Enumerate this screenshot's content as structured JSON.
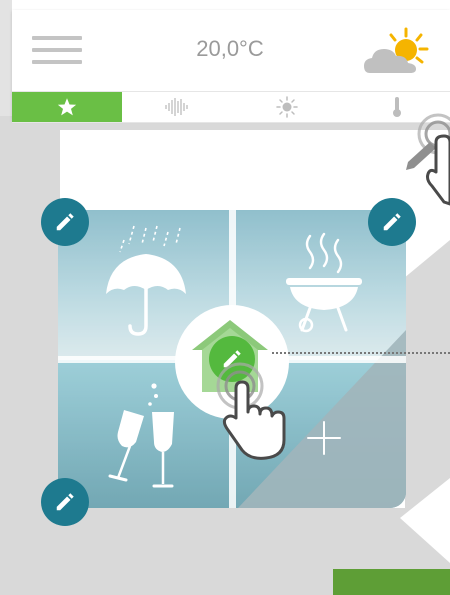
{
  "header": {
    "temperature": "20,0°C",
    "menu_icon": "hamburger-menu-icon",
    "weather_icon": "partly-sunny-icon"
  },
  "tabs": [
    {
      "id": "favorites",
      "icon": "star-icon",
      "active": true
    },
    {
      "id": "sound",
      "icon": "sound-wave-icon",
      "active": false
    },
    {
      "id": "light",
      "icon": "sun-icon",
      "active": false
    },
    {
      "id": "temperature",
      "icon": "thermometer-icon",
      "active": false
    }
  ],
  "scenes": [
    {
      "id": "rain",
      "icon": "umbrella-rain-icon"
    },
    {
      "id": "barbecue",
      "icon": "barbecue-grill-icon"
    },
    {
      "id": "party",
      "icon": "champagne-glasses-icon"
    },
    {
      "id": "add",
      "icon": "plus-icon"
    }
  ],
  "colors": {
    "accent_green": "#6abf45",
    "edit_button": "#1e7a8f",
    "edit_button_active": "#54b93e",
    "bottom_bar": "#5e9e36"
  }
}
